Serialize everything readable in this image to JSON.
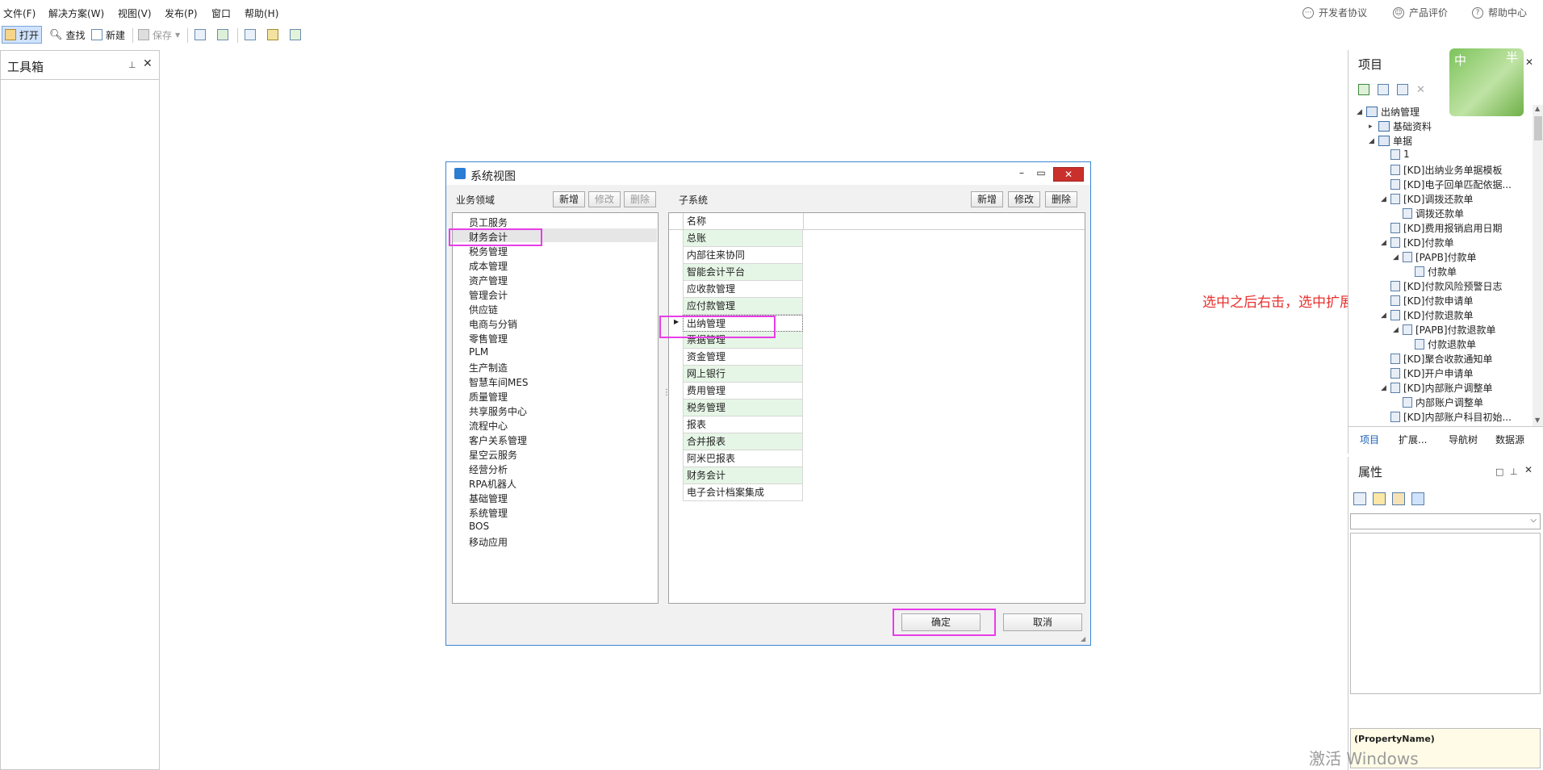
{
  "menu": [
    "文件(F)",
    "解决方案(W)",
    "视图(V)",
    "发布(P)",
    "窗口",
    "帮助(H)"
  ],
  "top_links": {
    "dev": "开发者协议",
    "rate": "产品评价",
    "help": "帮助中心"
  },
  "toolbar": {
    "open": "打开",
    "find": "查找",
    "new": "新建",
    "save": "保存"
  },
  "toolbox": {
    "title": "工具箱"
  },
  "dialog": {
    "title": "系统视图",
    "left_label": "业务领域",
    "right_label": "子系统",
    "btn_new": "新增",
    "btn_edit": "修改",
    "btn_delete": "删除",
    "grid_header": "名称",
    "ok": "确定",
    "cancel": "取消",
    "domains": [
      "员工服务",
      "财务会计",
      "税务管理",
      "成本管理",
      "资产管理",
      "管理会计",
      "供应链",
      "电商与分销",
      "零售管理",
      "PLM",
      "生产制造",
      "智慧车间MES",
      "质量管理",
      "共享服务中心",
      "流程中心",
      "客户关系管理",
      "星空云服务",
      "经营分析",
      "RPA机器人",
      "基础管理",
      "系统管理",
      "BOS",
      "移动应用"
    ],
    "subsystems": [
      "总账",
      "内部往来协同",
      "智能会计平台",
      "应收款管理",
      "应付款管理",
      "出纳管理",
      "票据管理",
      "资金管理",
      "网上银行",
      "费用管理",
      "税务管理",
      "报表",
      "合并报表",
      "阿米巴报表",
      "财务会计",
      "电子会计档案集成"
    ]
  },
  "project": {
    "title": "项目",
    "tree": [
      {
        "label": "出纳管理",
        "level": 0,
        "exp": "◢"
      },
      {
        "label": "基础资料",
        "level": 1,
        "exp": "▸"
      },
      {
        "label": "单据",
        "level": 1,
        "exp": "◢"
      },
      {
        "label": "1",
        "level": 2,
        "exp": ""
      },
      {
        "label": "[KD]出纳业务单据模板",
        "level": 2,
        "exp": ""
      },
      {
        "label": "[KD]电子回单匹配依据...",
        "level": 2,
        "exp": ""
      },
      {
        "label": "[KD]调拨还款单",
        "level": 2,
        "exp": "◢"
      },
      {
        "label": "调拨还款单",
        "level": 3,
        "exp": ""
      },
      {
        "label": "[KD]费用报销启用日期",
        "level": 2,
        "exp": ""
      },
      {
        "label": "[KD]付款单",
        "level": 2,
        "exp": "◢"
      },
      {
        "label": "[PAPB]付款单",
        "level": 3,
        "exp": "◢"
      },
      {
        "label": "付款单",
        "level": 4,
        "exp": ""
      },
      {
        "label": "[KD]付款风险预警日志",
        "level": 2,
        "exp": ""
      },
      {
        "label": "[KD]付款申请单",
        "level": 2,
        "exp": ""
      },
      {
        "label": "[KD]付款退款单",
        "level": 2,
        "exp": "◢"
      },
      {
        "label": "[PAPB]付款退款单",
        "level": 3,
        "exp": "◢"
      },
      {
        "label": "付款退款单",
        "level": 4,
        "exp": ""
      },
      {
        "label": "[KD]聚合收款通知单",
        "level": 2,
        "exp": ""
      },
      {
        "label": "[KD]开户申请单",
        "level": 2,
        "exp": ""
      },
      {
        "label": "[KD]内部账户调整单",
        "level": 2,
        "exp": "◢"
      },
      {
        "label": "内部账户调整单",
        "level": 3,
        "exp": ""
      },
      {
        "label": "[KD]内部账户科目初始...",
        "level": 2,
        "exp": ""
      }
    ],
    "tabs": [
      "项目",
      "扩展...",
      "导航树",
      "数据源"
    ]
  },
  "props": {
    "title": "属性",
    "property_name": "(PropertyName)"
  },
  "avatar": {
    "left": "中",
    "right": "半"
  },
  "annotation": "选中之后右击，选中扩展",
  "watermark": "激活 Windows"
}
